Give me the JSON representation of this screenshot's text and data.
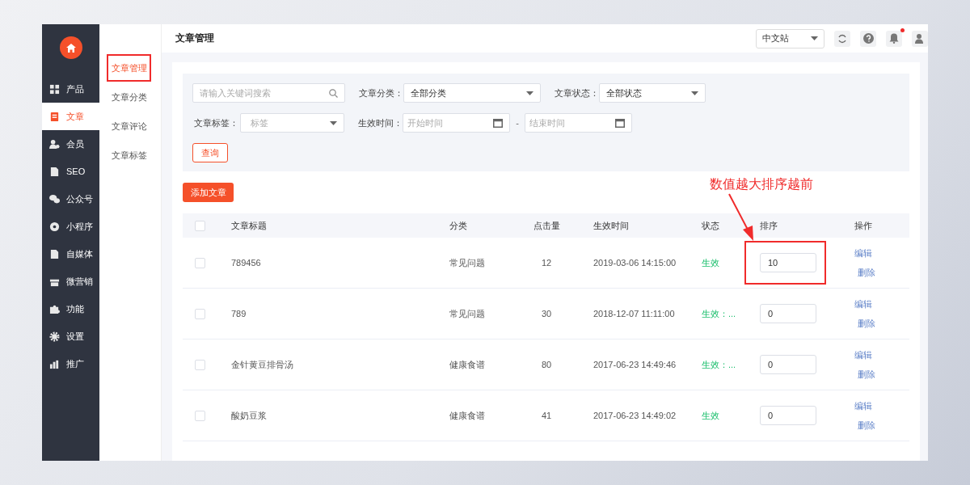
{
  "sidebar": {
    "items": [
      {
        "kind": "grid",
        "label": "产品",
        "selected": false
      },
      {
        "kind": "document",
        "label": "文章",
        "selected": true
      },
      {
        "kind": "users",
        "label": "会员",
        "selected": false
      },
      {
        "kind": "file",
        "label": "SEO",
        "selected": false
      },
      {
        "kind": "chat",
        "label": "公众号",
        "selected": false
      },
      {
        "kind": "globe",
        "label": "小程序",
        "selected": false
      },
      {
        "kind": "file",
        "label": "自媒体",
        "selected": false
      },
      {
        "kind": "gift",
        "label": "微营销",
        "selected": false
      },
      {
        "kind": "puzzle",
        "label": "功能",
        "selected": false
      },
      {
        "kind": "gear",
        "label": "设置",
        "selected": false
      },
      {
        "kind": "chart",
        "label": "推广",
        "selected": false
      }
    ]
  },
  "subnav": {
    "items": [
      {
        "label": "文章管理",
        "selected": true,
        "highlighted": true
      },
      {
        "label": "文章分类",
        "selected": false,
        "highlighted": false
      },
      {
        "label": "文章评论",
        "selected": false,
        "highlighted": false
      },
      {
        "label": "文章标签",
        "selected": false,
        "highlighted": false
      }
    ]
  },
  "header": {
    "title": "文章管理",
    "site_select": {
      "value": "中文站"
    },
    "has_unread": true
  },
  "filters": {
    "search": {
      "placeholder": "请输入关键词搜索"
    },
    "category": {
      "label": "文章分类：",
      "value": "全部分类"
    },
    "status": {
      "label": "文章状态：",
      "value": "全部状态"
    },
    "tag": {
      "label": "文章标签：",
      "placeholder": "标签"
    },
    "date_range": {
      "label": "生效时间：",
      "start_placeholder": "开始时间",
      "separator": "-",
      "end_placeholder": "结束时间"
    },
    "query_button": "查询"
  },
  "add_button": "添加文章",
  "annotation": {
    "text": "数值越大排序越前"
  },
  "table": {
    "select_all_checked": false,
    "columns": [
      "文章标题",
      "分类",
      "点击量",
      "生效时间",
      "状态",
      "排序",
      "操作"
    ],
    "rows": [
      {
        "checked": false,
        "title": "789456",
        "category": "常见问题",
        "clicks": "12",
        "time": "2019-03-06 14:15:00",
        "status": "生效",
        "sort": "10",
        "sort_highlighted": true,
        "actions": [
          "编辑",
          "删除"
        ]
      },
      {
        "checked": false,
        "title": "789",
        "category": "常见问题",
        "clicks": "30",
        "time": "2018-12-07 11:11:00",
        "status": "生效：...",
        "sort": "0",
        "sort_highlighted": false,
        "actions": [
          "编辑",
          "删除"
        ]
      },
      {
        "checked": false,
        "title": "金针黄豆排骨汤",
        "category": "健康食谱",
        "clicks": "80",
        "time": "2017-06-23 14:49:46",
        "status": "生效：...",
        "sort": "0",
        "sort_highlighted": false,
        "actions": [
          "编辑",
          "删除"
        ]
      },
      {
        "checked": false,
        "title": "酸奶豆浆",
        "category": "健康食谱",
        "clicks": "41",
        "time": "2017-06-23 14:49:02",
        "status": "生效",
        "sort": "0",
        "sort_highlighted": false,
        "actions": [
          "编辑",
          "删除"
        ]
      }
    ]
  }
}
